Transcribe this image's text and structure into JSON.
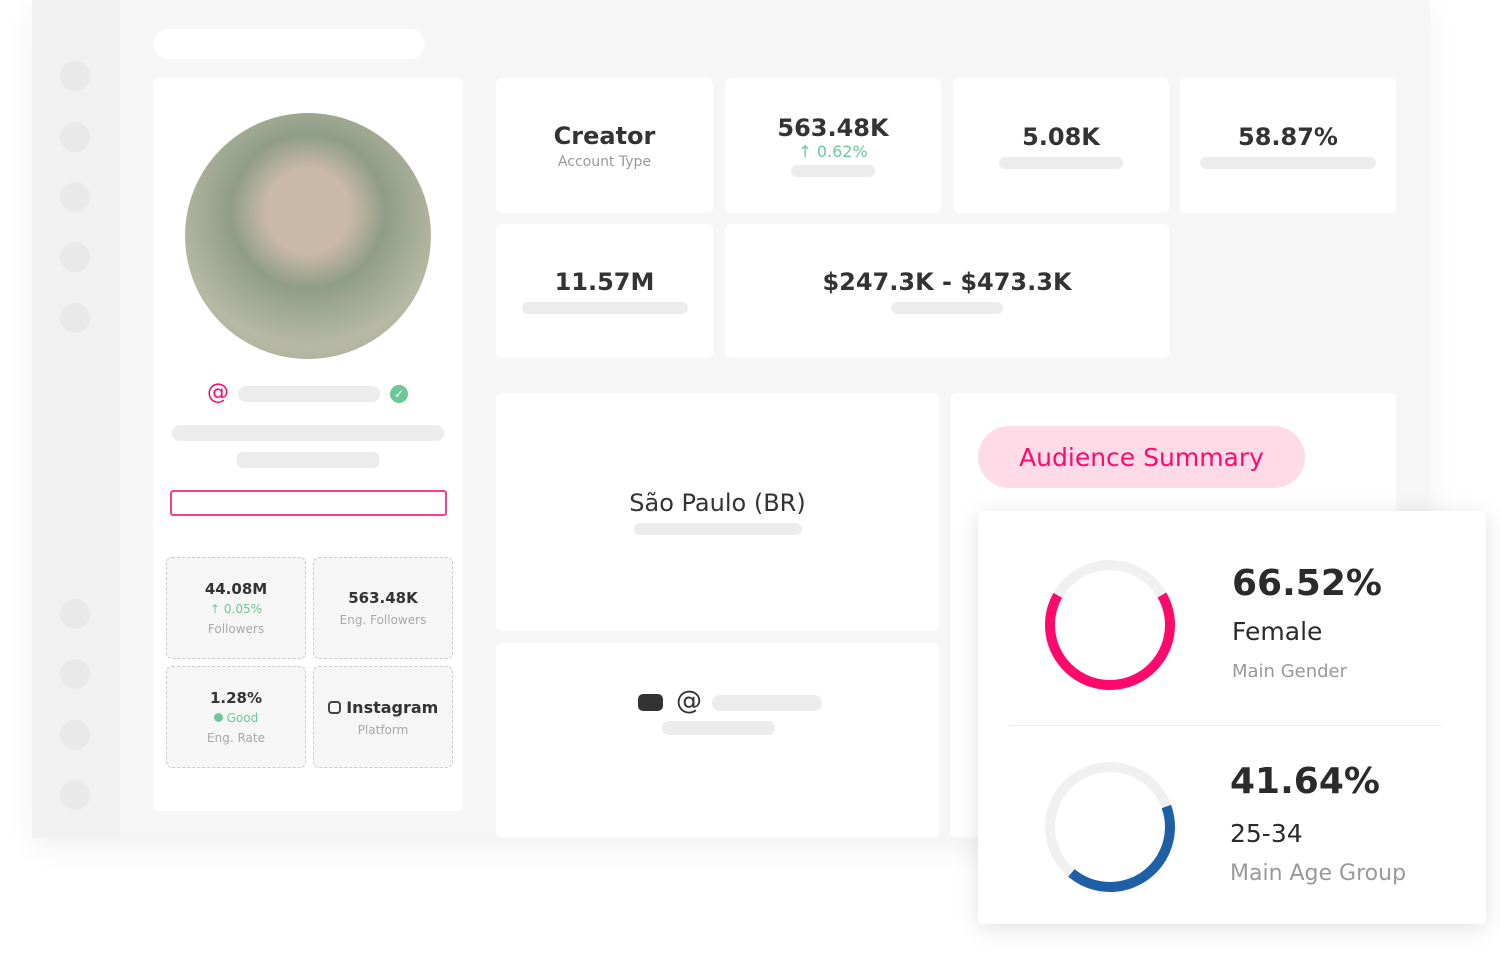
{
  "colors": {
    "accent": "#ff0a6c",
    "blue": "#1f5fa6",
    "green": "#6cc79b"
  },
  "profile": {
    "handle_icon": "at-icon",
    "verified_icon": "check-circle-icon",
    "stats": [
      {
        "value": "44.08M",
        "change": "↑ 0.05%",
        "label": "Followers"
      },
      {
        "value": "563.48K",
        "label": "Eng. Followers"
      },
      {
        "value": "1.28%",
        "status": "Good",
        "label": "Eng. Rate"
      },
      {
        "value": "Instagram",
        "label": "Platform",
        "icon": "instagram-icon"
      }
    ]
  },
  "metrics": {
    "account_type": {
      "value": "Creator",
      "label": "Account Type"
    },
    "engaged": {
      "value": "563.48K",
      "change": "↑ 0.62%"
    },
    "m3": {
      "value": "5.08K"
    },
    "m4": {
      "value": "58.87%"
    },
    "m5": {
      "value": "11.57M"
    },
    "price": {
      "value": "$247.3K - $473.3K"
    }
  },
  "location": {
    "value": "São Paulo (BR)"
  },
  "links": {
    "icons": [
      "youtube-icon",
      "at-icon"
    ],
    "at": "@"
  },
  "audience": {
    "title": "Audience Summary",
    "gender": {
      "percent": "66.52%",
      "value": "Female",
      "label": "Main Gender",
      "fraction": 0.6652
    },
    "age": {
      "percent": "41.64%",
      "value": "25-34",
      "label": "Main Age Group",
      "fraction": 0.4164
    }
  }
}
